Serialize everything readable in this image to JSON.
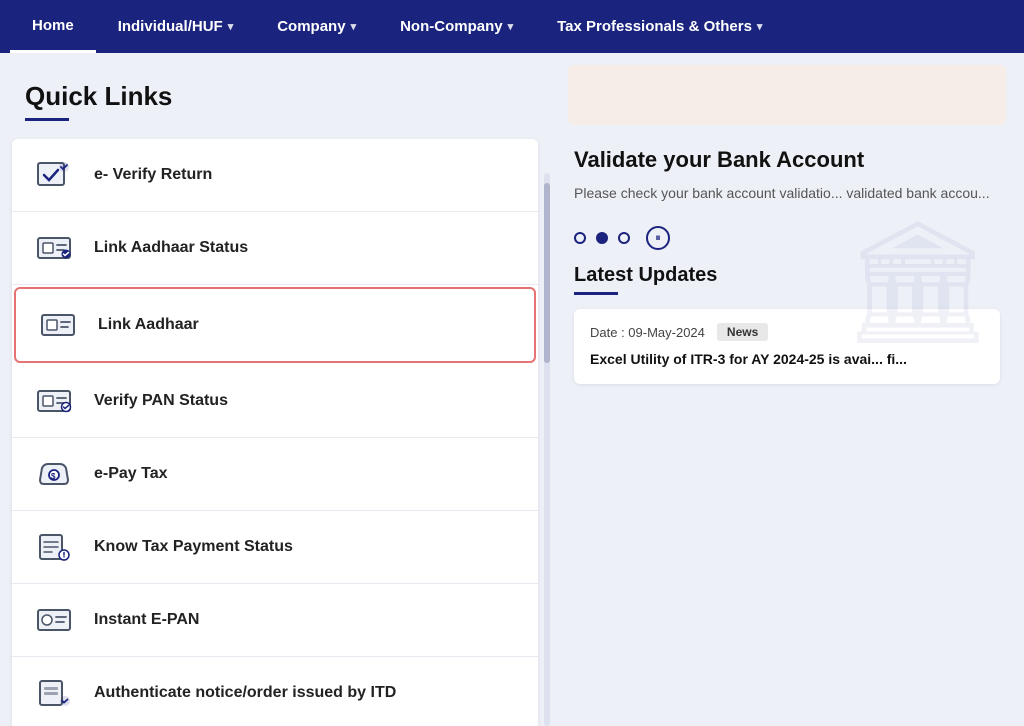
{
  "nav": {
    "items": [
      {
        "label": "Home",
        "hasChevron": false,
        "isHome": true
      },
      {
        "label": "Individual/HUF",
        "hasChevron": true,
        "isHome": false
      },
      {
        "label": "Company",
        "hasChevron": true,
        "isHome": false
      },
      {
        "label": "Non-Company",
        "hasChevron": true,
        "isHome": false
      },
      {
        "label": "Tax Professionals & Others",
        "hasChevron": true,
        "isHome": false
      }
    ]
  },
  "quickLinks": {
    "title": "Quick Links",
    "items": [
      {
        "id": "e-verify",
        "label": "e- Verify Return",
        "highlighted": false
      },
      {
        "id": "link-aadhaar-status",
        "label": "Link Aadhaar Status",
        "highlighted": false
      },
      {
        "id": "link-aadhaar",
        "label": "Link Aadhaar",
        "highlighted": true
      },
      {
        "id": "verify-pan",
        "label": "Verify PAN Status",
        "highlighted": false
      },
      {
        "id": "e-pay-tax",
        "label": "e-Pay Tax",
        "highlighted": false
      },
      {
        "id": "know-tax",
        "label": "Know Tax Payment Status",
        "highlighted": false
      },
      {
        "id": "instant-epan",
        "label": "Instant E-PAN",
        "highlighted": false
      },
      {
        "id": "authenticate",
        "label": "Authenticate notice/order issued by ITD",
        "highlighted": false
      }
    ]
  },
  "rightPanel": {
    "validateTitle": "Validate your Bank Account",
    "validateDesc": "Please check your bank account validatio... validated bank accou...",
    "carousel": {
      "dots": [
        false,
        true,
        false
      ],
      "paused": true
    },
    "latestUpdates": {
      "title": "Latest Updates",
      "cards": [
        {
          "date": "Date : 09-May-2024",
          "badge": "News",
          "text": "Excel Utility of ITR-3 for AY 2024-25 is avai... fi..."
        }
      ]
    }
  }
}
